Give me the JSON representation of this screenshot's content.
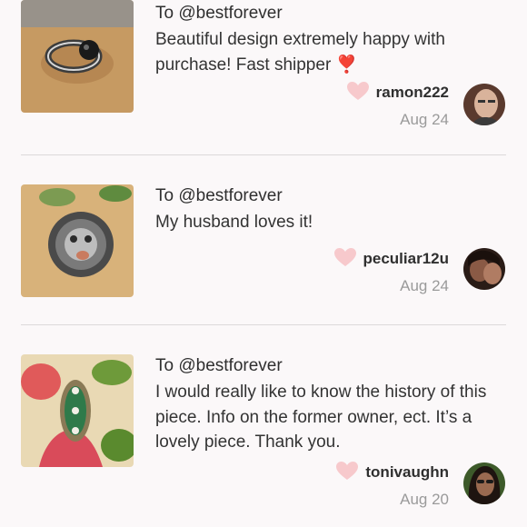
{
  "reviews": [
    {
      "to": "To @bestforever",
      "text": "Beautiful design extremely happy with purchase! Fast shipper ❣️",
      "username": "ramon222",
      "date": "Aug 24",
      "thumb_icon": "ring-black-stone-thumb",
      "avatar_icon": "avatar-ramon222"
    },
    {
      "to": "To @bestforever",
      "text": "My husband loves it!",
      "username": "peculiar12u",
      "date": "Aug 24",
      "thumb_icon": "ring-lion-head-thumb",
      "avatar_icon": "avatar-peculiar12u"
    },
    {
      "to": "To @bestforever",
      "text": "I would really like to know the history of this piece. Info on the former owner, ect. It’s a lovely piece. Thank you.",
      "username": "tonivaughn",
      "date": "Aug 20",
      "thumb_icon": "ring-emerald-marquise-thumb",
      "avatar_icon": "avatar-tonivaughn"
    }
  ],
  "colors": {
    "heart": "#f7c9cc",
    "divider": "#dcd9da",
    "date": "#9a9a9a"
  }
}
